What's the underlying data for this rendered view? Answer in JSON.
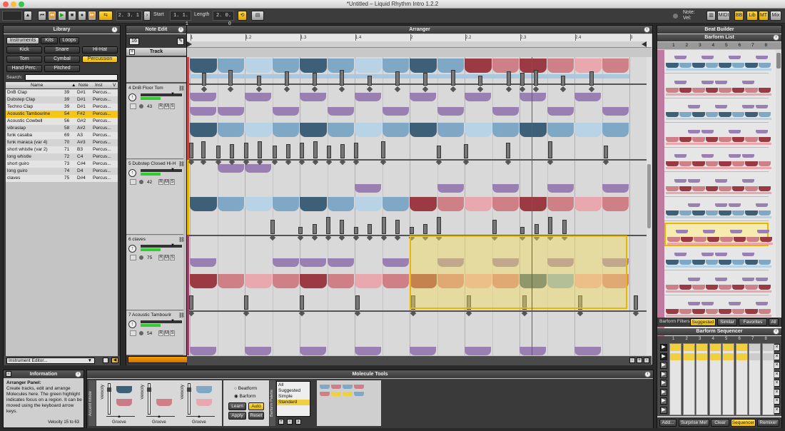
{
  "window": {
    "title": "*Untitled – Liquid Rhythm Intro 1.2.2"
  },
  "transport": {
    "position": "2. 3. 1",
    "start_label": "Start",
    "start": "1. 1. 1",
    "length_label": "Length",
    "length": "2. 0. 0",
    "note_label": "Note:",
    "vel_label": "Vel:",
    "midi": "MIDI",
    "bb": "BB",
    "lib": "Lib",
    "mt": "MT",
    "mix": "Mix"
  },
  "library": {
    "title": "Library",
    "tabs": [
      "Instruments",
      "Kits",
      "Loops"
    ],
    "categories": [
      "Kick",
      "Snare",
      "Hi-Hat",
      "Tom",
      "Cymbal",
      "Percussion",
      "Hand Perc.",
      "Pitched"
    ],
    "search_label": "Search:",
    "columns": {
      "name": "Name",
      "note": "Note",
      "inst": "Inst",
      "v": "V"
    },
    "rows": [
      {
        "name": "DnB Clap",
        "num": "39",
        "note": "D#1",
        "inst": "Percus..."
      },
      {
        "name": "Dubstep Clap",
        "num": "39",
        "note": "D#1",
        "inst": "Percus..."
      },
      {
        "name": "Techno Clap",
        "num": "39",
        "note": "D#1",
        "inst": "Percus..."
      },
      {
        "name": "Acoustic Tambourine",
        "num": "54",
        "note": "F#2",
        "inst": "Percus..."
      },
      {
        "name": "Acoustic Cowbell",
        "num": "56",
        "note": "G#2",
        "inst": "Percus..."
      },
      {
        "name": "vibraslap",
        "num": "58",
        "note": "A#2",
        "inst": "Percus..."
      },
      {
        "name": "funk casaba",
        "num": "69",
        "note": "A3",
        "inst": "Percus..."
      },
      {
        "name": "funk maraca (var 4)",
        "num": "70",
        "note": "A#3",
        "inst": "Percus..."
      },
      {
        "name": "short whistle (var 2)",
        "num": "71",
        "note": "B3",
        "inst": "Percus..."
      },
      {
        "name": "long whistle",
        "num": "72",
        "note": "C4",
        "inst": "Percus..."
      },
      {
        "name": "short guiro",
        "num": "73",
        "note": "C#4",
        "inst": "Percus..."
      },
      {
        "name": "long guiro",
        "num": "74",
        "note": "D4",
        "inst": "Percus..."
      },
      {
        "name": "claves",
        "num": "75",
        "note": "D#4",
        "inst": "Percus..."
      }
    ],
    "editor_button": "Instrument Editor..."
  },
  "note_edit": {
    "title": "Note Edit",
    "value": "16",
    "track_label": "Track"
  },
  "arranger": {
    "title": "Arranger",
    "ruler": [
      "1",
      "1.2",
      "1.3",
      "1.4",
      "2",
      "2.2",
      "2.3",
      "2.4",
      "3"
    ],
    "tracks": [
      {
        "name": "4 DnB Floor Tom",
        "vol": "43",
        "r": "R",
        "m": "M",
        "s": "S"
      },
      {
        "name": "5 Dubstep Closed Hi-H",
        "vol": "42",
        "r": "R",
        "m": "M",
        "s": "S"
      },
      {
        "name": "6 claves",
        "vol": "75",
        "r": "R",
        "m": "M",
        "s": "S"
      },
      {
        "name": "7 Acoustic Tambourir",
        "vol": "54",
        "r": "R",
        "m": "M",
        "s": "S"
      }
    ]
  },
  "beat_builder": {
    "title": "Beat Builder",
    "barform_list": "Barform List",
    "cols": [
      "1",
      "2",
      "3",
      "4",
      "5",
      "6",
      "7",
      "8"
    ],
    "rows": [
      "1",
      "2",
      "3",
      "4",
      "5",
      "6",
      "7",
      "8",
      "9",
      "10",
      "11"
    ],
    "filters_label": "Barform Filters",
    "filters": [
      "Suggested",
      "Similar",
      "Favorites",
      "All"
    ],
    "sequencer_title": "Barform Sequencer",
    "buttons": [
      "Add...",
      "Surprise Me!",
      "Clear",
      "Sequencer",
      "Remixer"
    ]
  },
  "information": {
    "title": "Information",
    "heading": "Arranger Panel:",
    "body": "Create tracks, edit and arrange Molecules here. The green highlight indicates focus on a region. It can be moved using the keyboard arrow keys.",
    "footer": "Velocity 15 to 63"
  },
  "molecule_tools": {
    "title": "Molecule Tools",
    "accent_mode": "Accent Mode",
    "velocity": "Velocity",
    "groove": "Groove",
    "opt_beatform": "Beatform",
    "opt_barform": "Barform",
    "learn": "Learn",
    "auto": "Auto",
    "apply": "Apply",
    "reset": "Reset",
    "barform_palette": "Barform Palette",
    "palette_items": [
      "All",
      "Suggested",
      "Simple",
      "Standard"
    ]
  },
  "colors": {
    "blue_dark": "#3e5f78",
    "blue": "#7fa8c6",
    "blue_light": "#b8d2e6",
    "red_dark": "#9c3a44",
    "red": "#cf7f86",
    "red_light": "#e8a8ad",
    "purple": "#9a7fb3",
    "yellow": "#f0d040",
    "playhead": "#d83020"
  }
}
